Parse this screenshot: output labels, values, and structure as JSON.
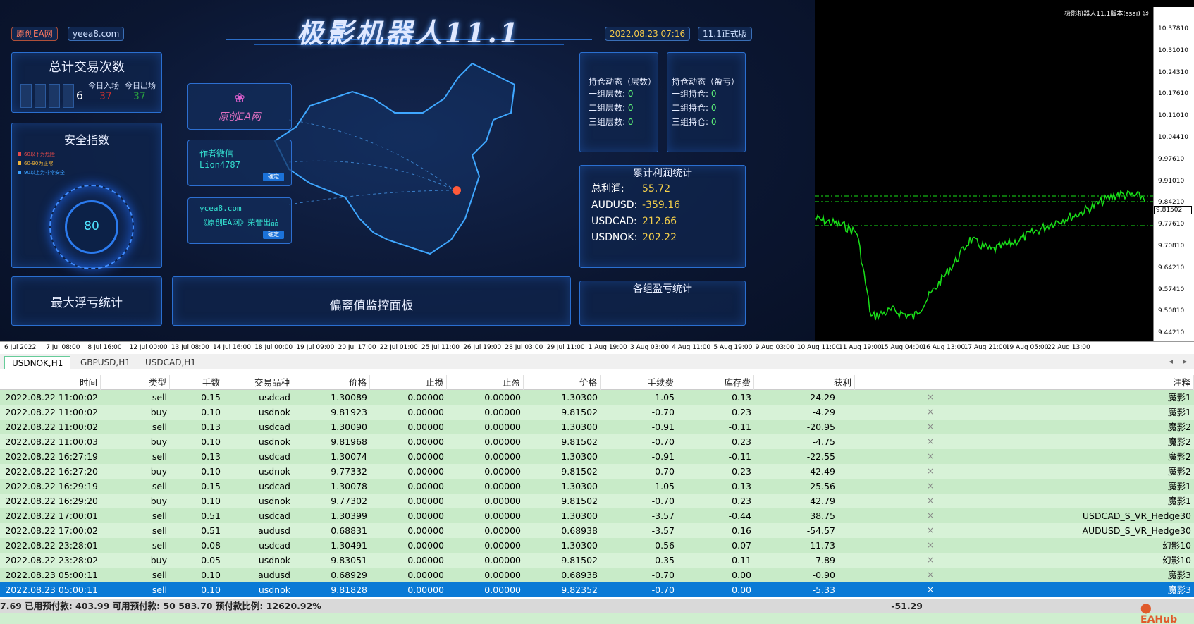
{
  "dashboard": {
    "title": "极影机器人11.1",
    "tag_left": "原创EA网",
    "tag_site": "yeea8.com",
    "datetime": "2022.08.23 07:16",
    "version": "11.1正式版",
    "trade_count": {
      "title": "总计交易次数",
      "value": "6",
      "in_label": "今日入场",
      "in_value": "37",
      "out_label": "今日出场",
      "out_value": "37"
    },
    "safety": {
      "title": "安全指数",
      "legend": [
        "60以下为危险",
        "60-90为正常",
        "90以上为非常安全"
      ],
      "value": "80"
    },
    "max_float": {
      "title": "最大浮亏统计"
    },
    "deviation": {
      "title": "偏离值监控面板"
    },
    "card_logo": {
      "text": "原创EA网"
    },
    "card_wechat": {
      "line1": "作者微信",
      "line2": "Lion4787",
      "button": "确定"
    },
    "card_site": {
      "line1": "ycea8.com",
      "line2": "《原创EA网》荣誉出品",
      "button": "确定"
    },
    "pos_layers": {
      "title": "持仓动态（层数）",
      "rows": [
        {
          "label": "一组层数:",
          "value": "0"
        },
        {
          "label": "二组层数:",
          "value": "0"
        },
        {
          "label": "三组层数:",
          "value": "0"
        }
      ]
    },
    "pos_pnl": {
      "title": "持仓动态（盈亏）",
      "rows": [
        {
          "label": "一组持仓:",
          "value": "0"
        },
        {
          "label": "二组持仓:",
          "value": "0"
        },
        {
          "label": "三组持仓:",
          "value": "0"
        }
      ]
    },
    "profit_stats": {
      "title": "累计利润统计",
      "rows": [
        {
          "label": "总利润:",
          "value": "55.72"
        },
        {
          "label": "AUDUSD:",
          "value": "-359.16"
        },
        {
          "label": "USDCAD:",
          "value": "212.66"
        },
        {
          "label": "USDNOK:",
          "value": "202.22"
        }
      ]
    },
    "group_pnl": {
      "title": "各组盈亏统计"
    }
  },
  "chart": {
    "caption": "极影机器人11.1版本(ssai) ☺",
    "current_price": "9.81502",
    "price_labels": [
      "10.37810",
      "10.31010",
      "10.24310",
      "10.17610",
      "10.11010",
      "10.04410",
      "9.97610",
      "9.91010",
      "9.84210",
      "9.77610",
      "9.70810",
      "9.64210",
      "9.57410",
      "9.50810",
      "9.44210"
    ],
    "time_labels": [
      "6 Jul 2022",
      "7 Jul 08:00",
      "8 Jul 16:00",
      "12 Jul 00:00",
      "13 Jul 08:00",
      "14 Jul 16:00",
      "18 Jul 00:00",
      "19 Jul 09:00",
      "20 Jul 17:00",
      "22 Jul 01:00",
      "25 Jul 11:00",
      "26 Jul 19:00",
      "28 Jul 03:00",
      "29 Jul 11:00",
      "1 Aug 19:00",
      "3 Aug 03:00",
      "4 Aug 11:00",
      "5 Aug 19:00",
      "9 Aug 03:00",
      "10 Aug 11:00",
      "11 Aug 19:00",
      "15 Aug 04:00",
      "16 Aug 13:00",
      "17 Aug 21:00",
      "19 Aug 05:00",
      "22 Aug 13:00"
    ]
  },
  "tabs": [
    "USDNOK,H1",
    "GBPUSD,H1",
    "USDCAD,H1"
  ],
  "table": {
    "headers": [
      "时间",
      "类型",
      "手数",
      "交易品种",
      "价格",
      "止损",
      "止盈",
      "价格",
      "手续费",
      "库存费",
      "获利",
      "注释"
    ],
    "rows": [
      [
        "2022.08.22 11:00:02",
        "sell",
        "0.15",
        "usdcad",
        "1.30089",
        "0.00000",
        "0.00000",
        "1.30300",
        "-1.05",
        "-0.13",
        "-24.29",
        "魔影1"
      ],
      [
        "2022.08.22 11:00:02",
        "buy",
        "0.10",
        "usdnok",
        "9.81923",
        "0.00000",
        "0.00000",
        "9.81502",
        "-0.70",
        "0.23",
        "-4.29",
        "魔影1"
      ],
      [
        "2022.08.22 11:00:02",
        "sell",
        "0.13",
        "usdcad",
        "1.30090",
        "0.00000",
        "0.00000",
        "1.30300",
        "-0.91",
        "-0.11",
        "-20.95",
        "魔影2"
      ],
      [
        "2022.08.22 11:00:03",
        "buy",
        "0.10",
        "usdnok",
        "9.81968",
        "0.00000",
        "0.00000",
        "9.81502",
        "-0.70",
        "0.23",
        "-4.75",
        "魔影2"
      ],
      [
        "2022.08.22 16:27:19",
        "sell",
        "0.13",
        "usdcad",
        "1.30074",
        "0.00000",
        "0.00000",
        "1.30300",
        "-0.91",
        "-0.11",
        "-22.55",
        "魔影2"
      ],
      [
        "2022.08.22 16:27:20",
        "buy",
        "0.10",
        "usdnok",
        "9.77332",
        "0.00000",
        "0.00000",
        "9.81502",
        "-0.70",
        "0.23",
        "42.49",
        "魔影2"
      ],
      [
        "2022.08.22 16:29:19",
        "sell",
        "0.15",
        "usdcad",
        "1.30078",
        "0.00000",
        "0.00000",
        "1.30300",
        "-1.05",
        "-0.13",
        "-25.56",
        "魔影1"
      ],
      [
        "2022.08.22 16:29:20",
        "buy",
        "0.10",
        "usdnok",
        "9.77302",
        "0.00000",
        "0.00000",
        "9.81502",
        "-0.70",
        "0.23",
        "42.79",
        "魔影1"
      ],
      [
        "2022.08.22 17:00:01",
        "sell",
        "0.51",
        "usdcad",
        "1.30399",
        "0.00000",
        "0.00000",
        "1.30300",
        "-3.57",
        "-0.44",
        "38.75",
        "USDCAD_S_VR_Hedge30"
      ],
      [
        "2022.08.22 17:00:02",
        "sell",
        "0.51",
        "audusd",
        "0.68831",
        "0.00000",
        "0.00000",
        "0.68938",
        "-3.57",
        "0.16",
        "-54.57",
        "AUDUSD_S_VR_Hedge30"
      ],
      [
        "2022.08.22 23:28:01",
        "sell",
        "0.08",
        "usdcad",
        "1.30491",
        "0.00000",
        "0.00000",
        "1.30300",
        "-0.56",
        "-0.07",
        "11.73",
        "幻影10"
      ],
      [
        "2022.08.22 23:28:02",
        "buy",
        "0.05",
        "usdnok",
        "9.83051",
        "0.00000",
        "0.00000",
        "9.81502",
        "-0.35",
        "0.11",
        "-7.89",
        "幻影10"
      ],
      [
        "2022.08.23 05:00:11",
        "sell",
        "0.10",
        "audusd",
        "0.68929",
        "0.00000",
        "0.00000",
        "0.68938",
        "-0.70",
        "0.00",
        "-0.90",
        "魔影3"
      ],
      [
        "2022.08.23 05:00:11",
        "sell",
        "0.10",
        "usdnok",
        "9.81828",
        "0.00000",
        "0.00000",
        "9.82352",
        "-0.70",
        "0.00",
        "-5.33",
        "魔影3"
      ]
    ],
    "selected_index": 13,
    "summary": "7.69  已用预付款: 403.99  可用预付款: 50 583.70  预付款比例: 12620.92%",
    "summary_total": "-51.29"
  },
  "watermark": "EAHub",
  "colors": {
    "accent": "#0a7ad6",
    "chart_line": "#19e019",
    "row_odd": "#c8ebc8",
    "row_even": "#d7f2d7"
  }
}
